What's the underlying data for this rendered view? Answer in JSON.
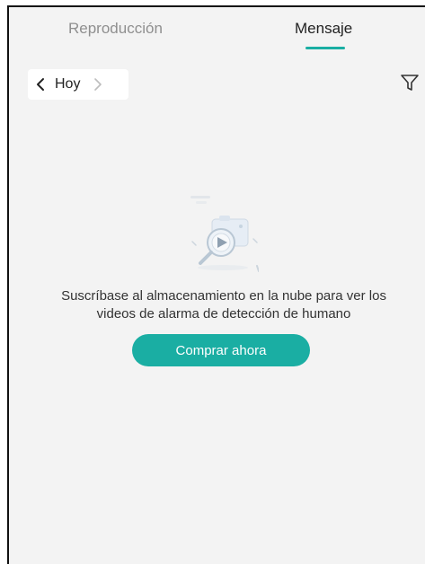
{
  "tabs": [
    {
      "label": "Reproducción",
      "active": false
    },
    {
      "label": "Mensaje",
      "active": true
    }
  ],
  "date_nav": {
    "prev_icon": "chevron-left-icon",
    "label": "Hoy",
    "next_icon": "chevron-right-icon"
  },
  "filter": {
    "icon": "filter-icon"
  },
  "empty_state": {
    "illustration_icon": "camera-search-illustration",
    "message_line1": "Suscríbase al almacenamiento en la nube para ver los",
    "message_line2": "videos de alarma de detección de humano",
    "button_label": "Comprar ahora"
  },
  "colors": {
    "accent": "#1aaea3",
    "background": "#f3f3f3",
    "inactive_tab": "#8f8f8f"
  }
}
